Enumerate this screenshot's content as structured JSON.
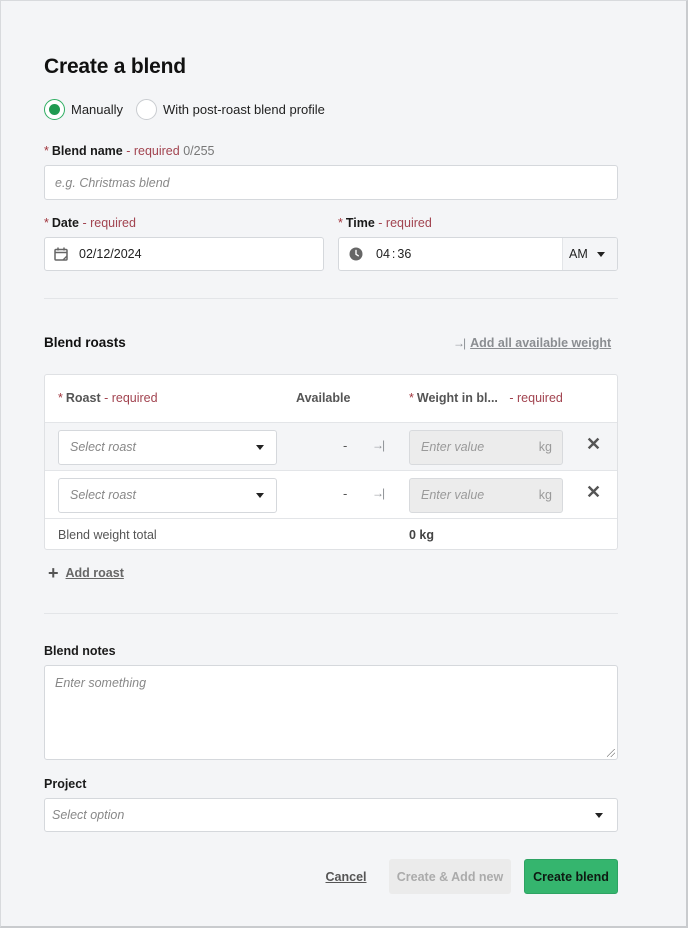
{
  "title": "Create a blend",
  "mode_options": [
    {
      "label": "Manually",
      "checked": true
    },
    {
      "label": "With post-roast blend profile",
      "checked": false
    }
  ],
  "blend_name": {
    "asterisk": "*",
    "label": "Blend name",
    "required": " - required",
    "counter": " 0/255",
    "placeholder": "e.g. Christmas blend"
  },
  "date": {
    "asterisk": "*",
    "label": "Date",
    "required": " - required",
    "value": "02/12/2024",
    "icon": "calendar-icon"
  },
  "time": {
    "asterisk": "*",
    "label": "Time",
    "required": " - required",
    "hours": "04",
    "separator": ":",
    "minutes": "36",
    "period": "AM",
    "icon": "clock-icon"
  },
  "blend_roasts": {
    "title": "Blend roasts",
    "add_all_label": "Add all available weight",
    "columns": {
      "roast": {
        "asterisk": "*",
        "label": "Roast",
        "required": " - required"
      },
      "available": {
        "label": "Available"
      },
      "weight": {
        "asterisk": "*",
        "label": "Weight in bl...",
        "required": " - required"
      }
    },
    "rows": [
      {
        "roast_placeholder": "Select roast",
        "available": "-",
        "weight_placeholder": "Enter value",
        "unit": "kg"
      },
      {
        "roast_placeholder": "Select roast",
        "available": "-",
        "weight_placeholder": "Enter value",
        "unit": "kg"
      }
    ],
    "total_label": "Blend weight total",
    "total_value": "0 kg",
    "add_roast_label": "Add roast"
  },
  "blend_notes": {
    "label": "Blend notes",
    "placeholder": "Enter something"
  },
  "project": {
    "label": "Project",
    "placeholder": "Select option"
  },
  "actions": {
    "cancel": "Cancel",
    "create_add_new": "Create & Add new",
    "create": "Create blend"
  },
  "colors": {
    "accent": "#35b56e",
    "required": "#a24450",
    "radio_checked": "#1f9a50"
  }
}
